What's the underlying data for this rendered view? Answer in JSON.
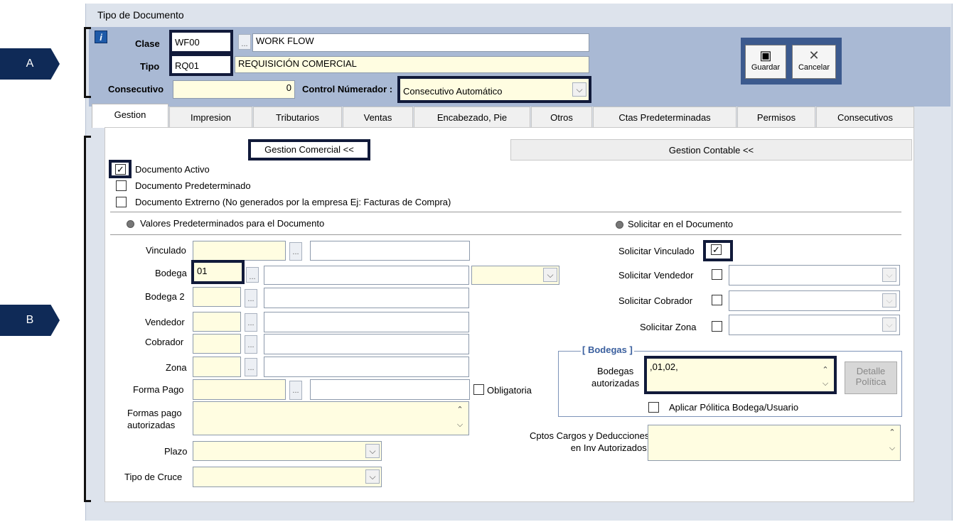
{
  "window": {
    "title": "Tipo de Documento"
  },
  "callouts": {
    "a": "A",
    "b": "B"
  },
  "header": {
    "clase_label": "Clase",
    "clase_code": "WF00",
    "clase_desc": "WORK FLOW",
    "tipo_label": "Tipo",
    "tipo_code": "RQ01",
    "tipo_desc": "REQUISICIÓN COMERCIAL",
    "consecutivo_label": "Consecutivo",
    "consecutivo_value": "0",
    "control_label": "Control Númerador :",
    "control_value": "Consecutivo Automático",
    "dots": "...",
    "info_icon_glyph": "i"
  },
  "toolbar": {
    "save_label": "Guardar",
    "cancel_label": "Cancelar",
    "save_icon": "floppy-icon",
    "cancel_icon": "close-icon"
  },
  "tabs": [
    {
      "label": "Gestion"
    },
    {
      "label": "Impresion"
    },
    {
      "label": "Tributarios"
    },
    {
      "label": "Ventas"
    },
    {
      "label": "Encabezado, Pie"
    },
    {
      "label": "Otros"
    },
    {
      "label": "Ctas Predeterminadas"
    },
    {
      "label": "Permisos"
    },
    {
      "label": "Consecutivos"
    }
  ],
  "subtabs": {
    "comercial": "Gestion Comercial <<",
    "contable": "Gestion Contable <<"
  },
  "checks": {
    "activo": "Documento Activo",
    "predeterminado": "Documento Predeterminado",
    "externo": "Documento Extrerno (No generados por la empresa  Ej: Facturas de Compra)"
  },
  "sections": {
    "valores": "Valores Predeterminados para el Documento",
    "solicitar": "Solicitar en el Documento"
  },
  "left_fields": {
    "vinculado": "Vinculado",
    "bodega": "Bodega",
    "bodega_value": "01",
    "bodega2": "Bodega 2",
    "vendedor": "Vendedor",
    "cobrador": "Cobrador",
    "zona": "Zona",
    "forma_pago": "Forma Pago",
    "obligatoria": "Obligatoria",
    "formas_pago_aut": "Formas pago\nautorizadas",
    "plazo": "Plazo",
    "tipo_cruce": "Tipo de Cruce"
  },
  "right_fields": {
    "solicitar_vinculado": "Solicitar Vinculado",
    "solicitar_vendedor": "Solicitar Vendedor",
    "solicitar_cobrador": "Solicitar Cobrador",
    "solicitar_zona": "Solicitar Zona",
    "bodegas_group": "[ Bodegas ]",
    "bodegas_aut_label": "Bodegas\nautorizadas",
    "bodegas_aut_value": ",01,02,",
    "detalle_btn": "Detalle\nPolítica",
    "aplicar_politica": "Aplicar Pólitica Bodega/Usuario",
    "cptos_label": "Cptos Cargos y Deducciones\nen Inv Autorizados:"
  },
  "glyphs": {
    "check": "✓",
    "down": "⌵",
    "up": "⌃"
  }
}
